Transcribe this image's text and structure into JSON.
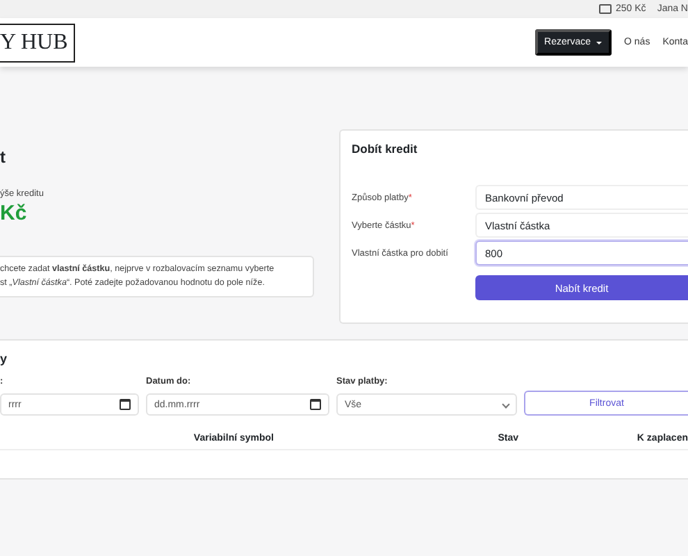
{
  "top_bar": {
    "credit": "250 Kč",
    "user": "Jana N"
  },
  "header": {
    "logo": "Y HUB",
    "nav": [
      {
        "label": "Rezervace",
        "kind": "dropdown"
      },
      {
        "label": "O nás",
        "kind": "link"
      },
      {
        "label": "Konta",
        "kind": "link"
      }
    ]
  },
  "credit_panel": {
    "title": "t",
    "balance_label": "ýše kreditu",
    "balance": "Kč",
    "info": [
      "chcete zadat **vlastní částku**, nejprve v rozbalovacím seznamu vyberte",
      "st „*Vlastní částka*“. Poté zadejte požadovanou hodnotu do pole níže."
    ]
  },
  "topup": {
    "title": "Dobít kredit",
    "fields": [
      {
        "label": "Způsob platby",
        "required_mark": "*",
        "value": "Bankovní převod",
        "focused": false
      },
      {
        "label": "Vyberte částku",
        "required_mark": "*",
        "value": "Vlastní částka",
        "focused": false
      },
      {
        "label": "Vlastní částka pro dobití",
        "value": "800",
        "focused": true
      }
    ],
    "button": "Nabít kredit"
  },
  "payments": {
    "title": "y",
    "filters": [
      {
        "label": ":",
        "placeholder": "rrrr",
        "kind": "date"
      },
      {
        "label": "Datum do:",
        "placeholder": "dd.mm.rrrr",
        "kind": "date"
      },
      {
        "label": "Stav platby:",
        "value": "Vše",
        "kind": "select"
      }
    ],
    "filter_button": "Filtrovat",
    "columns": [
      "Variabilní symbol",
      "Stav",
      "K zaplacen"
    ]
  }
}
